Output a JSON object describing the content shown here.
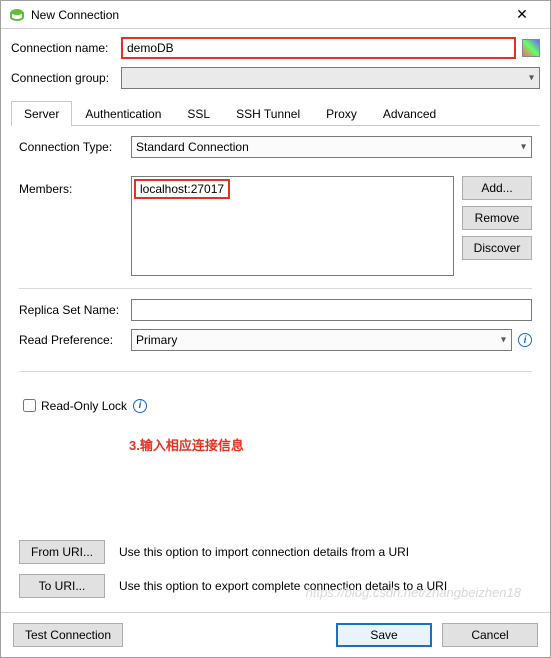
{
  "window": {
    "title": "New Connection"
  },
  "fields": {
    "conn_name_label": "Connection name:",
    "conn_name_value": "demoDB",
    "conn_group_label": "Connection group:",
    "conn_group_value": ""
  },
  "tabs": {
    "server": "Server",
    "auth": "Authentication",
    "ssl": "SSL",
    "ssh": "SSH Tunnel",
    "proxy": "Proxy",
    "advanced": "Advanced"
  },
  "server": {
    "conn_type_label": "Connection Type:",
    "conn_type_value": "Standard Connection",
    "members_label": "Members:",
    "member0": "localhost:27017",
    "add": "Add...",
    "remove": "Remove",
    "discover": "Discover",
    "replica_label": "Replica Set Name:",
    "replica_value": "",
    "readpref_label": "Read Preference:",
    "readpref_value": "Primary",
    "readonly_label": "Read-Only Lock"
  },
  "annotation": "3.输入相应连接信息",
  "uri": {
    "from_btn": "From URI...",
    "from_desc": "Use this option to import connection details from a URI",
    "to_btn": "To URI...",
    "to_desc": "Use this option to export complete connection details to a URI"
  },
  "footer": {
    "test": "Test Connection",
    "save": "Save",
    "cancel": "Cancel"
  },
  "watermark": "https://blog.csdn.net/zhangbeizhen18"
}
